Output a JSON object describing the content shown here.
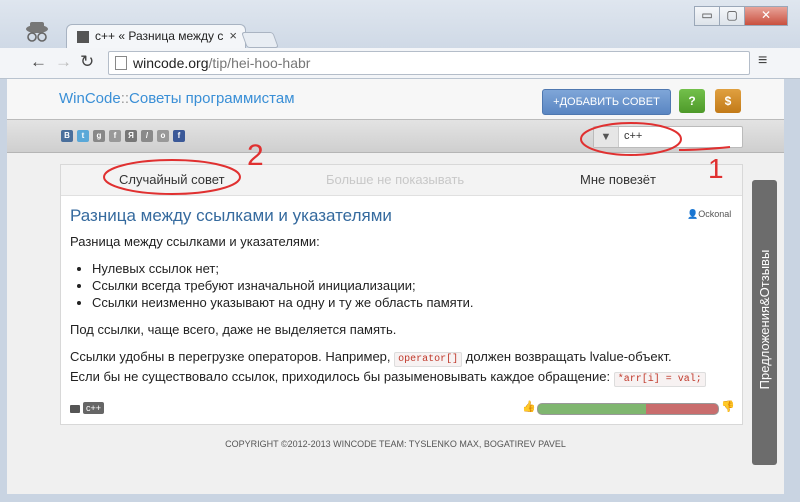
{
  "browser": {
    "tab_title": "c++ « Разница между ссы",
    "tab_close": "×",
    "url_domain": "wincode.org",
    "url_path": "/tip/hei-hoo-habr",
    "window_buttons": [
      "▭",
      "▢",
      "✕"
    ]
  },
  "site": {
    "logo_main": "WinCode",
    "logo_sep": "::",
    "logo_sub": "Советы программистам",
    "add_button": "+ДОБАВИТЬ СОВЕТ",
    "help_button": "?",
    "donate_button": "$",
    "filter_value": "c++",
    "social_icons": [
      "vk",
      "twitter",
      "google",
      "friendfeed",
      "yandex",
      "livejournal",
      "odnoklassniki",
      "facebook"
    ]
  },
  "tabs": {
    "random": "Случайный совет",
    "hide": "Больше не показывать",
    "lucky": "Мне повезёт"
  },
  "tip": {
    "title": "Разница между ссылками и указателями",
    "author": "Ockonal",
    "intro": "Разница между ссылками и указателями:",
    "bullets": [
      "Нулевых ссылок нет;",
      "Ссылки всегда требуют изначальной инициализации;",
      "Ссылки неизменно указывают на одну и ту же область памяти."
    ],
    "p1": "Под ссылки, чаще всего, даже не выделяется память.",
    "p2_a": "Ссылки удобны в перегрузке операторов. Например,",
    "p2_code": "operator[]",
    "p2_b": "должен возвращать lvalue-объект.",
    "p3_a": "Если бы не существовало ссылок, приходилось бы разыменовывать каждое обращение:",
    "p3_code": "*arr[i] = val;",
    "tag": "c++",
    "vote_positive_fraction": 0.6
  },
  "footer": {
    "copyright": "COPYRIGHT ©2012-2013 WINCODE TEAM: TYSLENKO MAX, BOGATIREV PAVEL"
  },
  "feedback": {
    "label": "Предложения&Отзывы"
  },
  "annotations": {
    "num1": "1",
    "num2": "2"
  },
  "colors": {
    "link_blue": "#356a9e",
    "accent_red": "#e03030",
    "vote_green": "#7fb66f",
    "vote_red": "#c96d6d"
  }
}
